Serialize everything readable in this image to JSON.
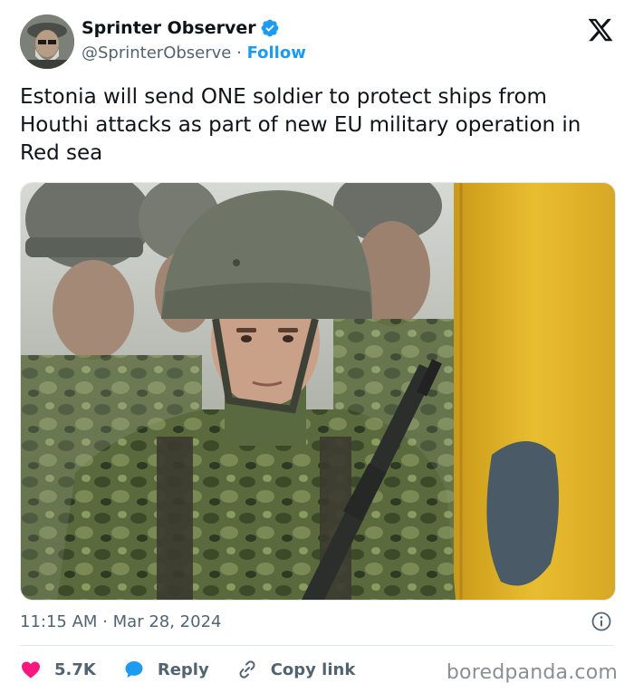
{
  "author": {
    "display_name": "Sprinter Observer",
    "handle": "@SprinterObserve",
    "separator": "·",
    "follow_label": "Follow"
  },
  "tweet": {
    "text": "Estonia will send ONE soldier to protect ships from Houthi attacks as part of new EU military operation in Red sea",
    "time": "11:15 AM",
    "dot": "·",
    "date": "Mar 28, 2024"
  },
  "actions": {
    "likes": "5.7K",
    "reply_label": "Reply",
    "copy_label": "Copy link"
  },
  "watermark": "boredpanda.com",
  "colors": {
    "accent": "#1d9bf0",
    "like": "#f91880",
    "text": "#0f1419",
    "muted": "#536471"
  },
  "icons": [
    "verified-badge-icon",
    "x-logo-icon",
    "info-icon",
    "heart-icon",
    "reply-bubble-icon",
    "link-icon"
  ]
}
